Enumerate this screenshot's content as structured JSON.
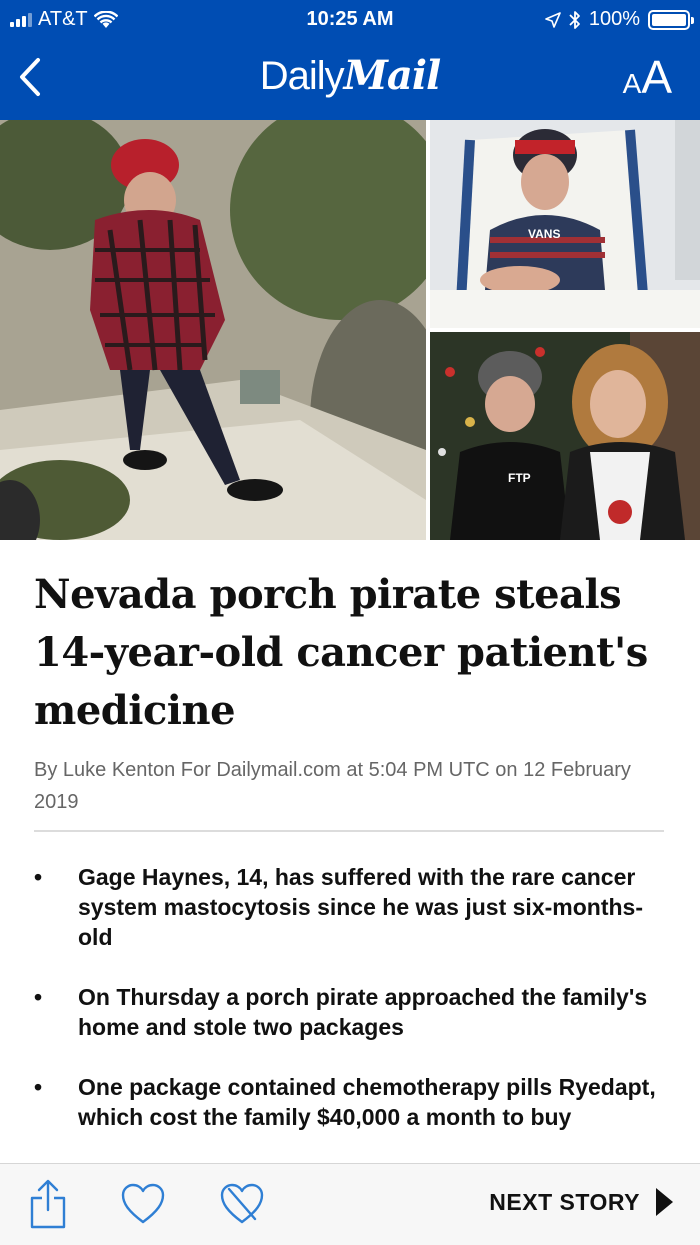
{
  "status_bar": {
    "carrier": "AT&T",
    "time": "10:25 AM",
    "battery": "100%"
  },
  "nav": {
    "brand_daily": "Daily",
    "brand_mail": "Mail",
    "text_size_small": "A",
    "text_size_large": "A",
    "brand_color": "#004db3"
  },
  "hero": {
    "sweatshirt_text": "FTP",
    "jersey_text": "VANS"
  },
  "article": {
    "headline": "Nevada porch pirate steals 14-year-old cancer patient's medicine",
    "byline": "By Luke Kenton For Dailymail.com at 5:04 PM UTC on 12 February 2019",
    "bullets": [
      "Gage Haynes, 14, has suffered with the rare cancer system mastocytosis since he was just six-months-old",
      "On Thursday a porch pirate approached the family's home and stole two packages",
      "One package contained chemotherapy pills Ryedapt, which cost the family $40,000 a month to buy"
    ],
    "bullet_glyph": "•"
  },
  "toolbar": {
    "next_story_label": "NEXT STORY",
    "icon_color": "#2f7fd4",
    "icons": [
      "share-icon",
      "heart-icon",
      "heart-crossed-icon",
      "play-arrow-icon"
    ]
  }
}
